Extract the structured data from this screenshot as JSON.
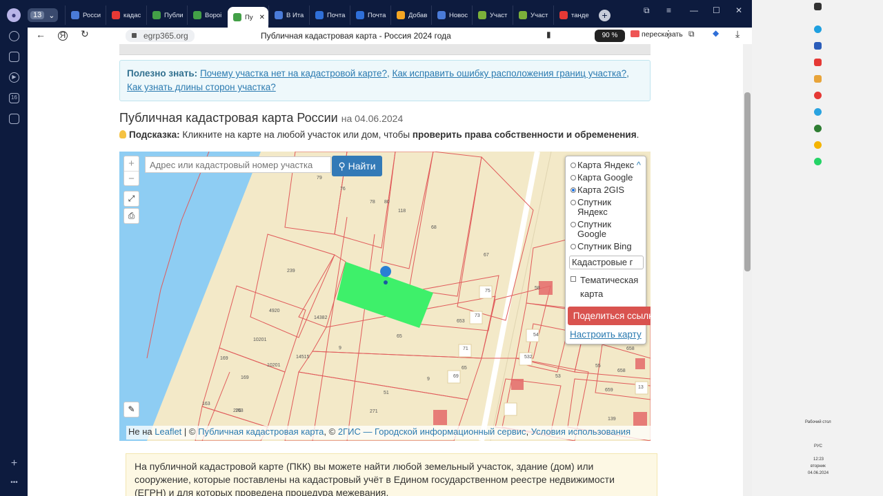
{
  "browser": {
    "tab_count": "13",
    "tabs": [
      {
        "label": "Росси",
        "color": "#4a7bd8"
      },
      {
        "label": "кадас",
        "color": "#e53935"
      },
      {
        "label": "Публи",
        "color": "#43a047"
      },
      {
        "label": "Вороі",
        "color": "#43a047"
      },
      {
        "label": "Пу",
        "color": "#43a047",
        "active": true
      },
      {
        "label": "В Ита",
        "color": "#4a7bd8"
      },
      {
        "label": "Почта",
        "color": "#2f6fd8"
      },
      {
        "label": "Почта",
        "color": "#2f6fd8"
      },
      {
        "label": "Добав",
        "color": "#f5a623"
      },
      {
        "label": "Новос",
        "color": "#4a7bd8"
      },
      {
        "label": "Участ",
        "color": "#7bb03a"
      },
      {
        "label": "Участ",
        "color": "#7bb03a"
      },
      {
        "label": "танде",
        "color": "#e53935"
      }
    ],
    "url": "egrp365.org",
    "page_title": "Публичная кадастровая карта - Россия 2024 года",
    "zoom": "90 %",
    "retell": "пересказать",
    "left_badge": "16"
  },
  "page": {
    "info_label": "Полезно знать:",
    "info_links": [
      "Почему участка нет на кадастровой карте?",
      "Как исправить ошибку расположения границ участка?",
      "Как узнать длины сторон участка?"
    ],
    "title": "Публичная кадастровая карта России",
    "date": "на 04.06.2024",
    "hint_label": "Подсказка:",
    "hint_text": "Кликните на карте на любой участок или дом, чтобы",
    "hint_bold": "проверить права собственности и обременения",
    "description": "На публичной кадастровой карте (ПКК) вы можете найти любой земельный участок, здание (дом) или сооружение, которые поставлены на кадастровый учёт в Едином государственном реестре недвижимости (ЕГРН) и для которых проведена процедура межевания."
  },
  "map": {
    "search_placeholder": "Адрес или кадастровый номер участка",
    "find_label": "Найти",
    "zoom_in": "+",
    "zoom_out": "−",
    "layers": [
      "Карта Яндекс",
      "Карта Google",
      "Карта 2GIS",
      "Спутник Яндекс",
      "Спутник Google",
      "Спутник Bing"
    ],
    "selected_layer": "Карта 2GIS",
    "overlay_select": "Кадастровые г",
    "thematic_label": "Тематическая карта",
    "share_label": "Поделиться ссылкой",
    "configure_label": "Настроить карту",
    "attribution_prefix": "Не на",
    "attribution_leaflet": "Leaflet",
    "attribution_links": [
      "Публичная кадастровая карта",
      "2ГИС — Городской информационный сервис",
      "Условия использования"
    ],
    "parcel_labels": [
      "76",
      "79",
      "78",
      "80",
      "118",
      "68",
      "67",
      "239",
      "75",
      "58",
      "4920",
      "14382",
      "653",
      "73",
      "10201",
      "65",
      "9",
      "54",
      "14515",
      "71",
      "169",
      "10201",
      "532",
      "65",
      "55",
      "658",
      "169",
      "69",
      "9",
      "53",
      "658",
      "163",
      "270",
      "51",
      "659",
      "163",
      "271",
      "139",
      "13"
    ],
    "selected_parcel_color": "#3ef06a"
  },
  "desktop": {
    "tray_label": "Рабочий стол",
    "lang": "РУС",
    "time": "12:23",
    "weekday": "вторник",
    "date": "04.06.2024"
  }
}
